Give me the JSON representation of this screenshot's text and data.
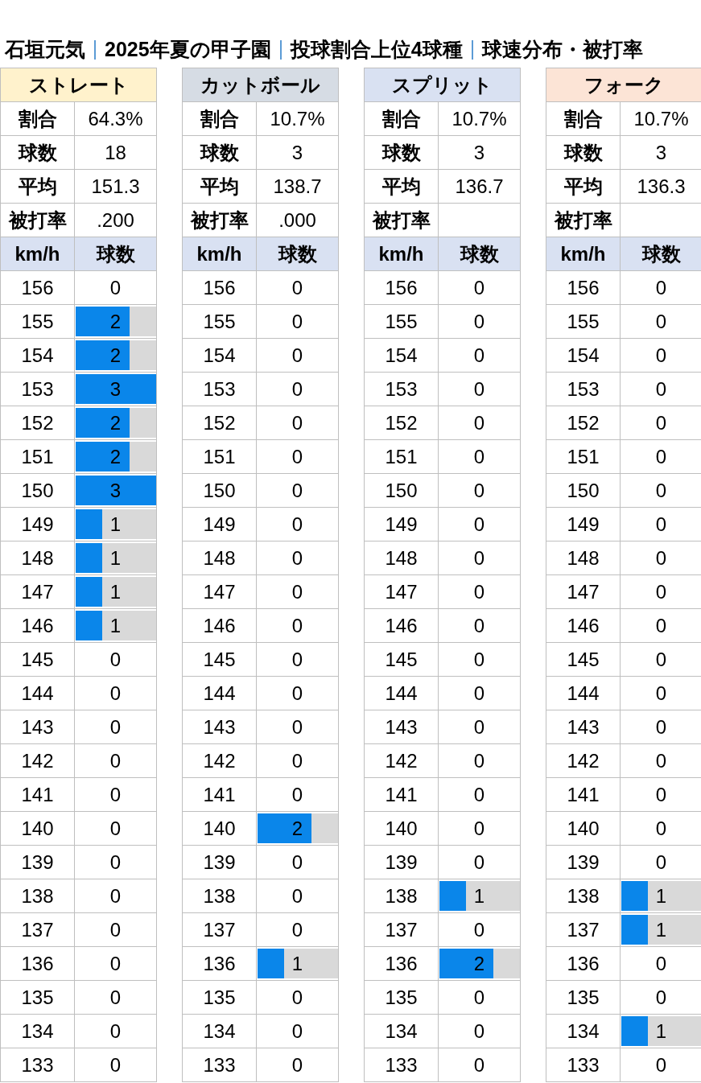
{
  "title": [
    "石垣元気",
    "2025年夏の甲子園",
    "投球割合上位4球種",
    "球速分布・被打"
  ],
  "title_tail": "率",
  "pitches": [
    {
      "name": "ストレート",
      "color": "#fff2cc",
      "stats": [
        {
          "label": "割合",
          "value": "64.3%"
        },
        {
          "label": "球数",
          "value": "18"
        },
        {
          "label": "平均",
          "value": "151.3"
        },
        {
          "label": "被打率",
          "value": ".200"
        }
      ],
      "columns": [
        "km/h",
        "球数"
      ],
      "rows": [
        {
          "speed": "156",
          "count": "0"
        },
        {
          "speed": "155",
          "count": "2",
          "level": 0.667
        },
        {
          "speed": "154",
          "count": "2",
          "level": 0.667
        },
        {
          "speed": "153",
          "count": "3",
          "level": 1
        },
        {
          "speed": "152",
          "count": "2",
          "level": 0.667
        },
        {
          "speed": "151",
          "count": "2",
          "level": 0.667
        },
        {
          "speed": "150",
          "count": "3",
          "level": 1
        },
        {
          "speed": "149",
          "count": "1",
          "level": 0.333
        },
        {
          "speed": "148",
          "count": "1",
          "level": 0.333
        },
        {
          "speed": "147",
          "count": "1",
          "level": 0.333
        },
        {
          "speed": "146",
          "count": "1",
          "level": 0.333
        },
        {
          "speed": "145",
          "count": "0"
        },
        {
          "speed": "144",
          "count": "0"
        },
        {
          "speed": "143",
          "count": "0"
        },
        {
          "speed": "142",
          "count": "0"
        },
        {
          "speed": "141",
          "count": "0"
        },
        {
          "speed": "140",
          "count": "0"
        },
        {
          "speed": "139",
          "count": "0"
        },
        {
          "speed": "138",
          "count": "0"
        },
        {
          "speed": "137",
          "count": "0"
        },
        {
          "speed": "136",
          "count": "0"
        },
        {
          "speed": "135",
          "count": "0"
        },
        {
          "speed": "134",
          "count": "0"
        },
        {
          "speed": "133",
          "count": "0"
        }
      ]
    },
    {
      "name": "カットボール",
      "color": "#d6dce4",
      "stats": [
        {
          "label": "割合",
          "value": "10.7%"
        },
        {
          "label": "球数",
          "value": "3"
        },
        {
          "label": "平均",
          "value": "138.7"
        },
        {
          "label": "被打率",
          "value": ".000"
        }
      ],
      "columns": [
        "km/h",
        "球数"
      ],
      "rows": [
        {
          "speed": "156",
          "count": "0"
        },
        {
          "speed": "155",
          "count": "0"
        },
        {
          "speed": "154",
          "count": "0"
        },
        {
          "speed": "153",
          "count": "0"
        },
        {
          "speed": "152",
          "count": "0"
        },
        {
          "speed": "151",
          "count": "0"
        },
        {
          "speed": "150",
          "count": "0"
        },
        {
          "speed": "149",
          "count": "0"
        },
        {
          "speed": "148",
          "count": "0"
        },
        {
          "speed": "147",
          "count": "0"
        },
        {
          "speed": "146",
          "count": "0"
        },
        {
          "speed": "145",
          "count": "0"
        },
        {
          "speed": "144",
          "count": "0"
        },
        {
          "speed": "143",
          "count": "0"
        },
        {
          "speed": "142",
          "count": "0"
        },
        {
          "speed": "141",
          "count": "0"
        },
        {
          "speed": "140",
          "count": "2",
          "level": 0.667
        },
        {
          "speed": "139",
          "count": "0"
        },
        {
          "speed": "138",
          "count": "0"
        },
        {
          "speed": "137",
          "count": "0"
        },
        {
          "speed": "136",
          "count": "1",
          "level": 0.333
        },
        {
          "speed": "135",
          "count": "0"
        },
        {
          "speed": "134",
          "count": "0"
        },
        {
          "speed": "133",
          "count": "0"
        }
      ]
    },
    {
      "name": "スプリット",
      "color": "#d9e1f2",
      "stats": [
        {
          "label": "割合",
          "value": "10.7%"
        },
        {
          "label": "球数",
          "value": "3"
        },
        {
          "label": "平均",
          "value": "136.7"
        },
        {
          "label": "被打率"
        }
      ],
      "columns": [
        "km/h",
        "球数"
      ],
      "rows": [
        {
          "speed": "156",
          "count": "0"
        },
        {
          "speed": "155",
          "count": "0"
        },
        {
          "speed": "154",
          "count": "0"
        },
        {
          "speed": "153",
          "count": "0"
        },
        {
          "speed": "152",
          "count": "0"
        },
        {
          "speed": "151",
          "count": "0"
        },
        {
          "speed": "150",
          "count": "0"
        },
        {
          "speed": "149",
          "count": "0"
        },
        {
          "speed": "148",
          "count": "0"
        },
        {
          "speed": "147",
          "count": "0"
        },
        {
          "speed": "146",
          "count": "0"
        },
        {
          "speed": "145",
          "count": "0"
        },
        {
          "speed": "144",
          "count": "0"
        },
        {
          "speed": "143",
          "count": "0"
        },
        {
          "speed": "142",
          "count": "0"
        },
        {
          "speed": "141",
          "count": "0"
        },
        {
          "speed": "140",
          "count": "0"
        },
        {
          "speed": "139",
          "count": "0"
        },
        {
          "speed": "138",
          "count": "1",
          "level": 0.333
        },
        {
          "speed": "137",
          "count": "0"
        },
        {
          "speed": "136",
          "count": "2",
          "level": 0.667
        },
        {
          "speed": "135",
          "count": "0"
        },
        {
          "speed": "134",
          "count": "0"
        },
        {
          "speed": "133",
          "count": "0"
        }
      ]
    },
    {
      "name": "フォーク",
      "color": "#fce4d6",
      "stats": [
        {
          "label": "割合",
          "value": "10.7%"
        },
        {
          "label": "球数",
          "value": "3"
        },
        {
          "label": "平均",
          "value": "136.3"
        },
        {
          "label": "被打率"
        }
      ],
      "columns": [
        "km/h",
        "球数"
      ],
      "rows": [
        {
          "speed": "156",
          "count": "0"
        },
        {
          "speed": "155",
          "count": "0"
        },
        {
          "speed": "154",
          "count": "0"
        },
        {
          "speed": "153",
          "count": "0"
        },
        {
          "speed": "152",
          "count": "0"
        },
        {
          "speed": "151",
          "count": "0"
        },
        {
          "speed": "150",
          "count": "0"
        },
        {
          "speed": "149",
          "count": "0"
        },
        {
          "speed": "148",
          "count": "0"
        },
        {
          "speed": "147",
          "count": "0"
        },
        {
          "speed": "146",
          "count": "0"
        },
        {
          "speed": "145",
          "count": "0"
        },
        {
          "speed": "144",
          "count": "0"
        },
        {
          "speed": "143",
          "count": "0"
        },
        {
          "speed": "142",
          "count": "0"
        },
        {
          "speed": "141",
          "count": "0"
        },
        {
          "speed": "140",
          "count": "0"
        },
        {
          "speed": "139",
          "count": "0"
        },
        {
          "speed": "138",
          "count": "1",
          "level": 0.333
        },
        {
          "speed": "137",
          "count": "1",
          "level": 0.333
        },
        {
          "speed": "136",
          "count": "0"
        },
        {
          "speed": "135",
          "count": "0"
        },
        {
          "speed": "134",
          "count": "1",
          "level": 0.333
        },
        {
          "speed": "133",
          "count": "0"
        }
      ]
    }
  ]
}
